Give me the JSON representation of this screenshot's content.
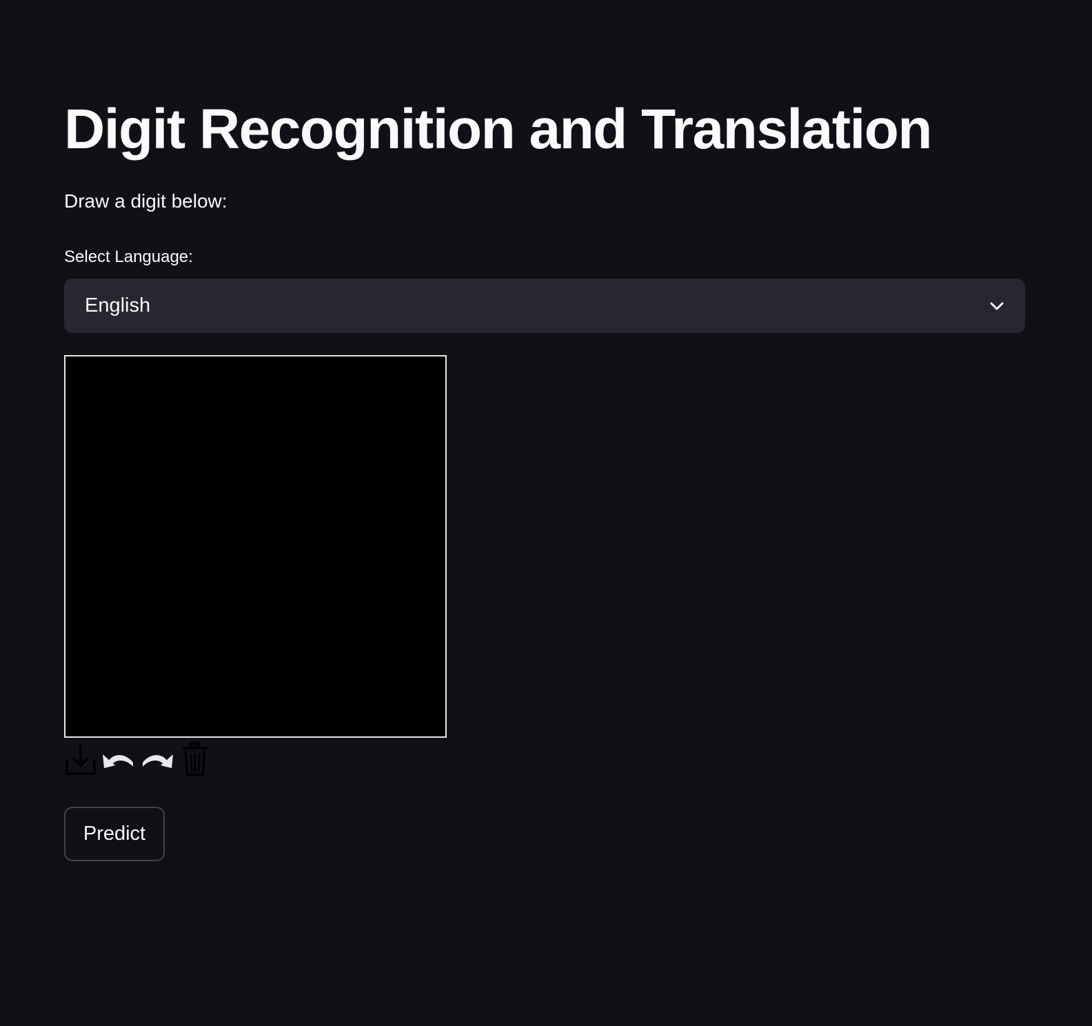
{
  "app": {
    "title": "Digit Recognition and Translation",
    "subtitle": "Draw a digit below:"
  },
  "language_select": {
    "label": "Select Language:",
    "selected": "English",
    "icon": "chevron-down-icon"
  },
  "canvas": {
    "background_color": "#000000",
    "border_color": "#e8e8e8"
  },
  "canvas_toolbar": {
    "tools": [
      {
        "name": "download",
        "icon": "download-icon"
      },
      {
        "name": "undo",
        "icon": "undo-icon"
      },
      {
        "name": "redo",
        "icon": "redo-icon"
      },
      {
        "name": "clear",
        "icon": "trash-icon"
      }
    ]
  },
  "actions": {
    "predict_label": "Predict"
  },
  "colors": {
    "background": "#0f1117",
    "select_background": "#262730",
    "text": "#fafafa"
  }
}
